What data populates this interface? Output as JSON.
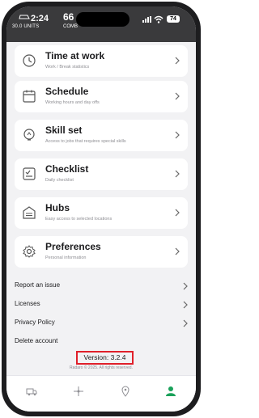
{
  "status": {
    "time": "2:24",
    "speed": "66",
    "units": "30.0 UNITS",
    "comb": "COMB",
    "battery": "74"
  },
  "cards": [
    {
      "title": "Time at work",
      "sub": "Work / Break statistics",
      "icon": "clock-icon"
    },
    {
      "title": "Schedule",
      "sub": "Working hours and day offs",
      "icon": "calendar-icon"
    },
    {
      "title": "Skill set",
      "sub": "Access to jobs that requires special skills",
      "icon": "lightbulb-icon"
    },
    {
      "title": "Checklist",
      "sub": "Daily checklist",
      "icon": "checklist-icon"
    },
    {
      "title": "Hubs",
      "sub": "Easy access to selected locations",
      "icon": "warehouse-icon"
    },
    {
      "title": "Preferences",
      "sub": "Personal information",
      "icon": "gear-icon"
    }
  ],
  "links": [
    {
      "label": "Report an issue",
      "chevron": true
    },
    {
      "label": "Licenses",
      "chevron": true
    },
    {
      "label": "Privacy Policy",
      "chevron": true
    },
    {
      "label": "Delete account",
      "chevron": false
    }
  ],
  "version": "Version: 3.2.4",
  "copyright": "Radaro © 2025. All rights reserved.",
  "tabs": [
    "truck-icon",
    "route-icon",
    "location-pin-icon",
    "profile-icon"
  ],
  "colors": {
    "accent": "#1aa15a",
    "highlight": "#e0202a"
  }
}
